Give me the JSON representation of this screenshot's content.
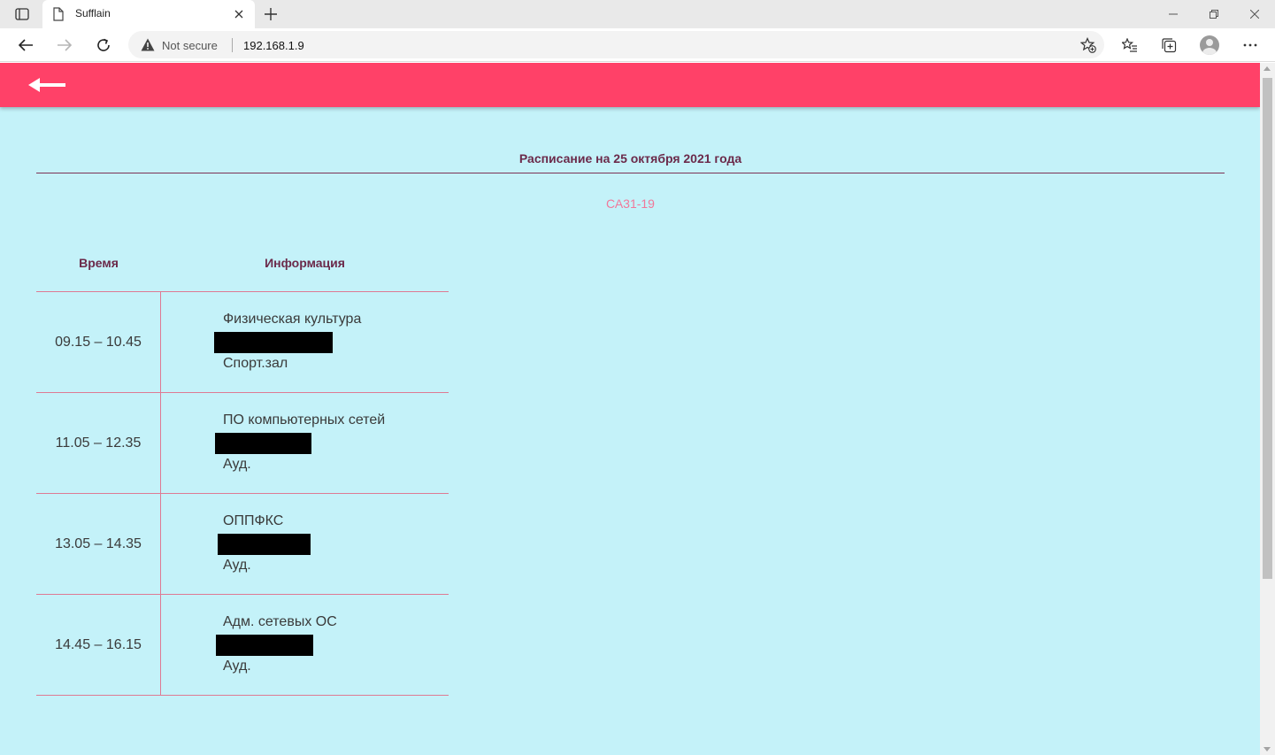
{
  "browser": {
    "tab_title": "Sufflain",
    "security_label": "Not secure",
    "url": "192.168.1.9"
  },
  "page": {
    "heading": "Расписание на 25 октября 2021 года",
    "group": "СА31-19",
    "columns": {
      "time": "Время",
      "info": "Информация"
    },
    "lessons": [
      {
        "time": "09.15 – 10.45",
        "subject": "Физическая культура",
        "room": "Спорт.зал"
      },
      {
        "time": "11.05 – 12.35",
        "subject": "ПО компьютерных сетей",
        "room": "Ауд."
      },
      {
        "time": "13.05 – 14.35",
        "subject": "ОППФКС",
        "room": "Ауд."
      },
      {
        "time": "14.45 – 16.15",
        "subject": "Адм. сетевых ОС",
        "room": "Ауд."
      }
    ]
  },
  "colors": {
    "appbar": "#ff4168",
    "background": "#c4f2f9",
    "heading": "#6b2a4a",
    "group": "#f1789a",
    "rules": "#de7a93"
  }
}
